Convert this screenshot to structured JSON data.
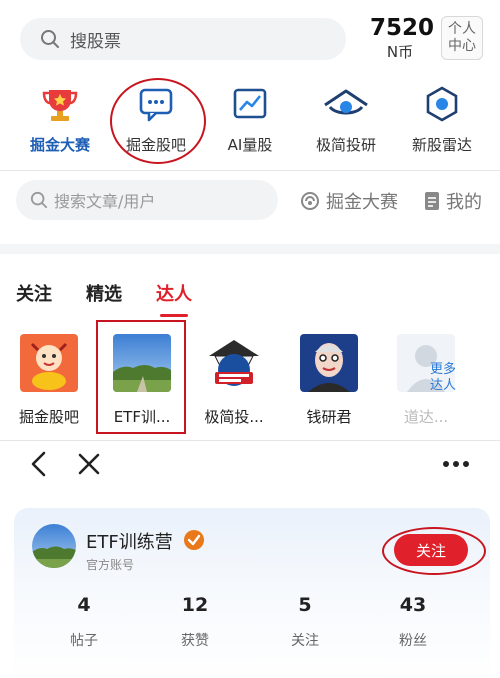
{
  "search": {
    "placeholder": "搜股票"
  },
  "coins": {
    "value": "7520",
    "unit": "N币"
  },
  "profile": {
    "line1": "个人",
    "line2": "中心"
  },
  "features": [
    {
      "label": "掘金大赛",
      "icon": "trophy-icon"
    },
    {
      "label": "掘金股吧",
      "icon": "chat-bubble-icon"
    },
    {
      "label": "AI量股",
      "icon": "line-chart-icon"
    },
    {
      "label": "极简投研",
      "icon": "eye-icon"
    },
    {
      "label": "新股雷达",
      "icon": "radar-hexagon-icon"
    }
  ],
  "community": {
    "search_placeholder": "搜索文章/用户",
    "contest_link": "掘金大赛",
    "mine_link": "我的"
  },
  "tabs": [
    {
      "label": "关注"
    },
    {
      "label": "精选"
    },
    {
      "label": "达人",
      "active": true
    }
  ],
  "experts": [
    {
      "name": "掘金股吧"
    },
    {
      "name": "ETF训..."
    },
    {
      "name": "极简投..."
    },
    {
      "name": "钱研君"
    },
    {
      "name": "道达..."
    }
  ],
  "more_experts": {
    "line1": "更多",
    "line2": "达人"
  },
  "navbar": {
    "back_icon": "back-arrow-icon",
    "close_icon": "close-icon",
    "more_icon": "more-dots-icon"
  },
  "account": {
    "name": "ETF训练营",
    "subtitle": "官方账号",
    "follow_label": "关注",
    "stats": [
      {
        "value": "4",
        "label": "帖子"
      },
      {
        "value": "12",
        "label": "获赞"
      },
      {
        "value": "5",
        "label": "关注"
      },
      {
        "value": "43",
        "label": "粉丝"
      }
    ]
  },
  "colors": {
    "accent_red": "#e0202a",
    "active_blue": "#1e5fb5",
    "annotation_red": "#c8141e"
  }
}
